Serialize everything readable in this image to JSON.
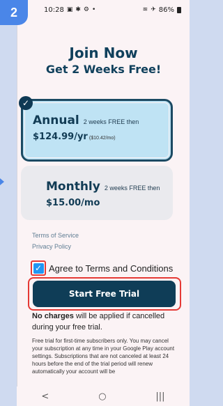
{
  "step": "2",
  "status_bar": {
    "time": "10:28",
    "left_icons": [
      "image-icon",
      "gear-icon",
      "settings-icon",
      "dot"
    ],
    "battery": "86%"
  },
  "header": {
    "title": "Join Now",
    "subtitle": "Get 2 Weeks Free!"
  },
  "plans": {
    "annual": {
      "name": "Annual",
      "description": "2 weeks FREE then",
      "price": "$124.99/yr",
      "per_month": "($10.42/mo)",
      "selected": true
    },
    "monthly": {
      "name": "Monthly",
      "description": "2 weeks FREE then",
      "price": "$15.00/mo",
      "selected": false
    }
  },
  "links": {
    "terms": "Terms of Service",
    "privacy": "Privacy Policy"
  },
  "agree": {
    "label": "Agree to Terms and Conditions",
    "checked": true
  },
  "cta": {
    "label": "Start Free Trial"
  },
  "notice": {
    "bold": "No charges",
    "rest": " will be applied if cancelled during your free trial."
  },
  "fineprint": "Free trial for first-time subscribers only. You may cancel your subscription at any time in your Google Play account settings. Subscriptions that are not canceled at least 24 hours before the end of the trial period will renew automatically your account will be",
  "navbar": {
    "back": "<",
    "home": "○",
    "recents": "|||"
  },
  "colors": {
    "accent": "#0f3d57",
    "highlight": "#e53935",
    "annual_bg": "#bfe3f4",
    "badge": "#4a86e8"
  }
}
